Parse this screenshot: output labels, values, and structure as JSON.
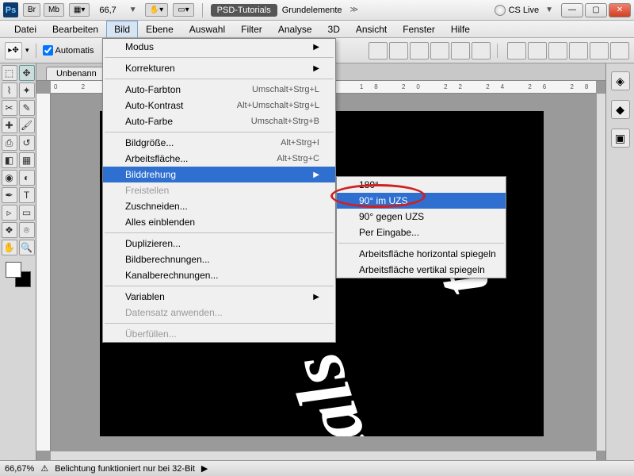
{
  "titlebar": {
    "logo": "Ps",
    "chips": [
      "Br",
      "Mb"
    ],
    "zoom": "66,7",
    "psd_btn": "PSD-Tutorials",
    "grundelemente": "Grundelemente",
    "cslive": "CS Live"
  },
  "menubar": [
    "Datei",
    "Bearbeiten",
    "Bild",
    "Ebene",
    "Auswahl",
    "Filter",
    "Analyse",
    "3D",
    "Ansicht",
    "Fenster",
    "Hilfe"
  ],
  "menu_open_index": 2,
  "options": {
    "checkbox": "Automatis"
  },
  "tab": {
    "label": "Unbenann"
  },
  "bild_menu": {
    "groups": [
      [
        {
          "label": "Modus",
          "sub": true
        }
      ],
      [
        {
          "label": "Korrekturen",
          "sub": true
        }
      ],
      [
        {
          "label": "Auto-Farbton",
          "shortcut": "Umschalt+Strg+L"
        },
        {
          "label": "Auto-Kontrast",
          "shortcut": "Alt+Umschalt+Strg+L"
        },
        {
          "label": "Auto-Farbe",
          "shortcut": "Umschalt+Strg+B"
        }
      ],
      [
        {
          "label": "Bildgröße...",
          "shortcut": "Alt+Strg+I"
        },
        {
          "label": "Arbeitsfläche...",
          "shortcut": "Alt+Strg+C"
        },
        {
          "label": "Bilddrehung",
          "sub": true,
          "highlighted": true
        },
        {
          "label": "Freistellen",
          "disabled": true
        },
        {
          "label": "Zuschneiden..."
        },
        {
          "label": "Alles einblenden"
        }
      ],
      [
        {
          "label": "Duplizieren..."
        },
        {
          "label": "Bildberechnungen..."
        },
        {
          "label": "Kanalberechnungen..."
        }
      ],
      [
        {
          "label": "Variablen",
          "sub": true
        },
        {
          "label": "Datensatz anwenden...",
          "disabled": true
        }
      ],
      [
        {
          "label": "Überfüllen...",
          "disabled": true
        }
      ]
    ]
  },
  "sub_menu": {
    "groups": [
      [
        {
          "label": "180°"
        },
        {
          "label": "90° im UZS",
          "highlighted": true
        },
        {
          "label": "90° gegen UZS"
        },
        {
          "label": "Per Eingabe..."
        }
      ],
      [
        {
          "label": "Arbeitsfläche horizontal spiegeln"
        },
        {
          "label": "Arbeitsfläche vertikal spiegeln"
        }
      ]
    ]
  },
  "status": {
    "zoom": "66,67%",
    "msg": "Belichtung funktioniert nur bei 32-Bit"
  },
  "canvas_word": "tals"
}
